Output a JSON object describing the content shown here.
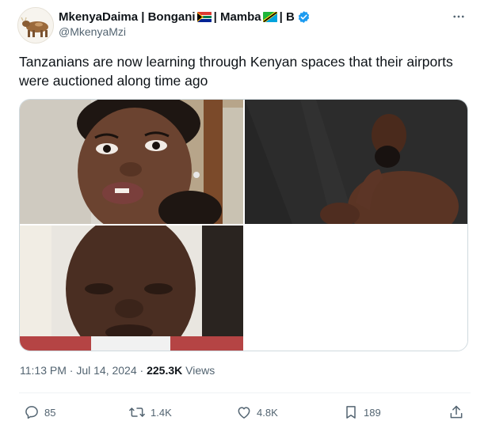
{
  "author": {
    "name_part1": "MkenyaDaima | Bongani",
    "name_part2": "| Mamba",
    "name_part3": "| B",
    "handle": "@MkenyaMzi",
    "flag_1": "south-africa-flag-icon",
    "flag_2": "tanzania-flag-icon",
    "verified_color": "#1d9bf0"
  },
  "tweet": {
    "text": "Tanzanians are now learning through Kenyan spaces that their airports were auctioned along time ago",
    "media": [
      "woman-selfie-image",
      "shirtless-man-image",
      "crying-man-image"
    ]
  },
  "meta": {
    "time": "11:13 PM",
    "sep1": " · ",
    "date": "Jul 14, 2024",
    "sep2": " · ",
    "views_count": "225.3K",
    "views_label": " Views"
  },
  "actions": {
    "replies": "85",
    "reposts": "1.4K",
    "likes": "4.8K",
    "bookmarks": "189"
  },
  "colors": {
    "text": "#0f1419",
    "secondary": "#536471",
    "border": "#cfd9de",
    "accent": "#1d9bf0"
  }
}
